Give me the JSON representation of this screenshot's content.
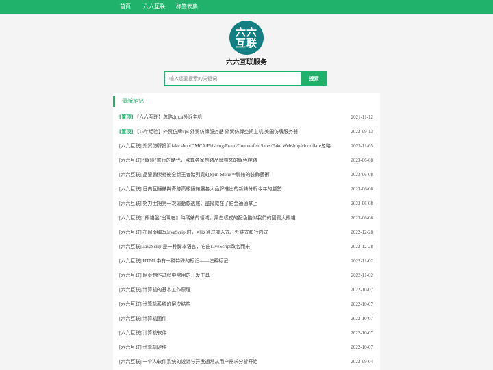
{
  "nav": {
    "items": [
      {
        "label": "首页"
      },
      {
        "label": "六六互联"
      },
      {
        "label": "标签云集"
      }
    ]
  },
  "logo": {
    "text": "六六互联"
  },
  "site": {
    "title": "六六互联服务"
  },
  "search": {
    "placeholder": "输入您要搜索的关键词",
    "button_label": "搜索"
  },
  "section": {
    "title": "最新笔记"
  },
  "colors": {
    "brand": "#20b26b",
    "logo_bg": "#137f83"
  },
  "posts": [
    {
      "pin": "[置顶]",
      "title": "【六六互联】忽略dmca投诉主机",
      "date": "2021-11-12"
    },
    {
      "pin": "[置顶]",
      "title": "【15年经验】外贸仿牌vps 外贸仿牌服务器 外贸仿牌空间主机 美国仿牌服务器",
      "date": "2022-09-13"
    },
    {
      "pin": "",
      "title": "[六六互联] 外贸仿牌投诉fake shop/DMCA/Phishing/Fraud/Counterfeit Sales/Fake Webshop/cloudflare忽略",
      "date": "2023-11-05"
    },
    {
      "pin": "",
      "title": "[六六互联] “綠鐘”盛行的時代，欧算各家制錶品牌帶來的綠色腕錶",
      "date": "2023-06-08"
    },
    {
      "pin": "",
      "title": "[六六互联] 品鑒霸傑杜彼全新王者骷列霓虹Spin-Stone™腕錶的裝飾藝術",
      "date": "2023-06-08"
    },
    {
      "pin": "",
      "title": "[六六互联] 日内瓦鐘錶與奇跡高級鐘錶展各大品牌推出的新錶分析今年的趨勢",
      "date": "2023-06-08"
    },
    {
      "pin": "",
      "title": "[六六互联] 努力士把第一次運動款透底，盡撥款在了鉑金通通拿上",
      "date": "2023-06-08"
    },
    {
      "pin": "",
      "title": "[六六互联] “熊貓盤”出現在計時碼錶的領域，黑白樣式的配色酷似我們的國寶大熊貓",
      "date": "2023-06-08"
    },
    {
      "pin": "",
      "title": "[六六互联] 在网页编写JavaScript时，可以通过嵌入式、外链式和行内式",
      "date": "2022-12-28"
    },
    {
      "pin": "",
      "title": "[六六互联] JavaScript是一种脚本语言，它由LiveScript改名而来",
      "date": "2022-12-28"
    },
    {
      "pin": "",
      "title": "[六六互联] HTML中有一种特殊的标记——注释标记",
      "date": "2022-11-02"
    },
    {
      "pin": "",
      "title": "[六六互联] 网页制作过程中常用的开发工具",
      "date": "2022-11-02"
    },
    {
      "pin": "",
      "title": "[六六互联] 计算机的基本工作原理",
      "date": "2022-10-07"
    },
    {
      "pin": "",
      "title": "[六六互联] 计算机系统的层次结构",
      "date": "2022-10-07"
    },
    {
      "pin": "",
      "title": "[六六互联] 计算机固件",
      "date": "2022-10-07"
    },
    {
      "pin": "",
      "title": "[六六互联] 计算机软件",
      "date": "2022-10-07"
    },
    {
      "pin": "",
      "title": "[六六互联] 计算机硬件",
      "date": "2022-10-07"
    },
    {
      "pin": "",
      "title": "[六六互联] 一个人软件系统的设计与开发通常从用户需求分析开始",
      "date": "2022-09-04"
    }
  ]
}
